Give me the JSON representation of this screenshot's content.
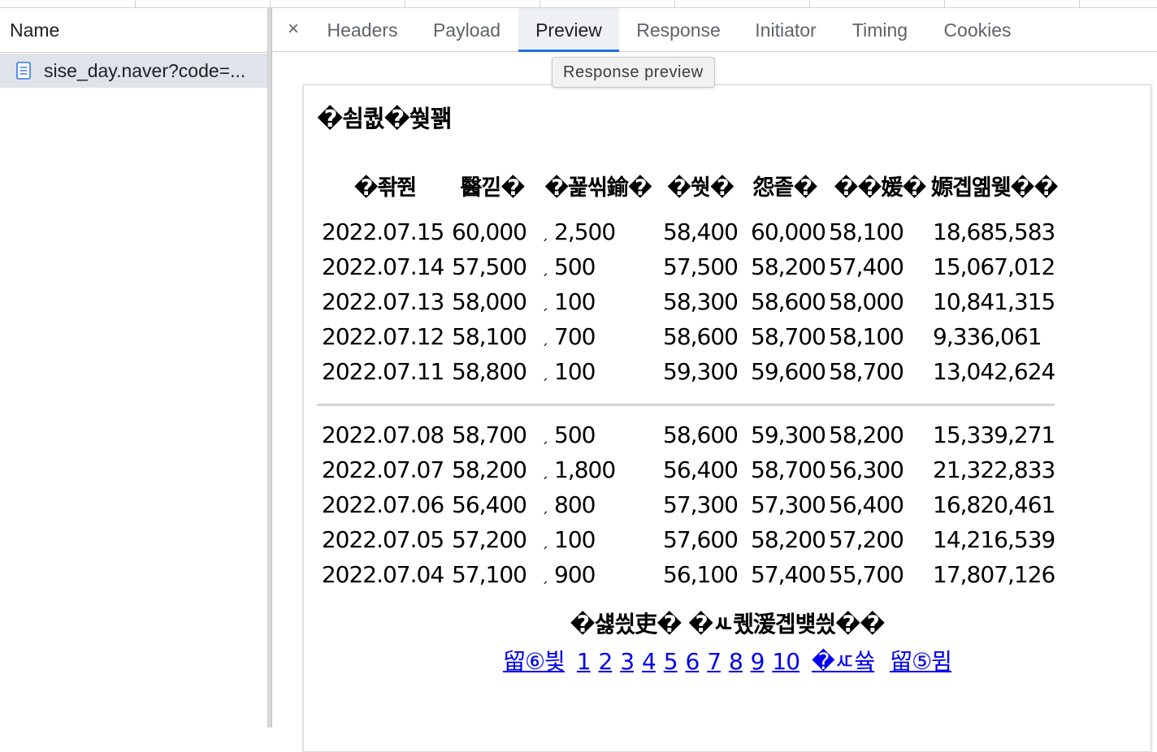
{
  "left_panel": {
    "column_header": "Name",
    "request_name": "sise_day.naver?code=..."
  },
  "tabs": {
    "close_icon": "×",
    "items": [
      "Headers",
      "Payload",
      "Preview",
      "Response",
      "Initiator",
      "Timing",
      "Cookies"
    ],
    "active": "Preview"
  },
  "tooltip": "Response preview",
  "preview": {
    "title": "�쇰퀎�쒖꽭",
    "headers": [
      "�좎쭨",
      "醫낃�",
      "�꾩씪鍮�",
      "�쒓�",
      "怨좉�",
      "��媛�",
      "嫄곕옒웾��"
    ],
    "rows_group1": [
      {
        "date": "2022.07.15",
        "close": "60,000",
        "arrow": "ˏ",
        "diff": "2,500",
        "open": "58,400",
        "high": "60,000",
        "low": "58,100",
        "volume": "18,685,583"
      },
      {
        "date": "2022.07.14",
        "close": "57,500",
        "arrow": "ˏ",
        "diff": "500",
        "open": "57,500",
        "high": "58,200",
        "low": "57,400",
        "volume": "15,067,012"
      },
      {
        "date": "2022.07.13",
        "close": "58,000",
        "arrow": "ˏ",
        "diff": "100",
        "open": "58,300",
        "high": "58,600",
        "low": "58,000",
        "volume": "10,841,315"
      },
      {
        "date": "2022.07.12",
        "close": "58,100",
        "arrow": "ˏ",
        "diff": "700",
        "open": "58,600",
        "high": "58,700",
        "low": "58,100",
        "volume": "9,336,061"
      },
      {
        "date": "2022.07.11",
        "close": "58,800",
        "arrow": "ˏ",
        "diff": "100",
        "open": "59,300",
        "high": "59,600",
        "low": "58,700",
        "volume": "13,042,624"
      }
    ],
    "rows_group2": [
      {
        "date": "2022.07.08",
        "close": "58,700",
        "arrow": "ˏ",
        "diff": "500",
        "open": "58,600",
        "high": "59,300",
        "low": "58,200",
        "volume": "15,339,271"
      },
      {
        "date": "2022.07.07",
        "close": "58,200",
        "arrow": "ˏ",
        "diff": "1,800",
        "open": "56,400",
        "high": "58,700",
        "low": "56,300",
        "volume": "21,322,833"
      },
      {
        "date": "2022.07.06",
        "close": "56,400",
        "arrow": "ˏ",
        "diff": "800",
        "open": "57,300",
        "high": "57,300",
        "low": "56,400",
        "volume": "16,820,461"
      },
      {
        "date": "2022.07.05",
        "close": "57,200",
        "arrow": "ˏ",
        "diff": "100",
        "open": "57,600",
        "high": "58,200",
        "low": "57,200",
        "volume": "14,216,539"
      },
      {
        "date": "2022.07.04",
        "close": "57,100",
        "arrow": "ˏ",
        "diff": "900",
        "open": "56,100",
        "high": "57,400",
        "low": "55,700",
        "volume": "17,807,126"
      }
    ],
    "footer_note": "�섏씠吏� �ㅻ퀬湲곕뱾씠��",
    "pager": {
      "first": "留⑥븿",
      "pages": [
        "1",
        "2",
        "3",
        "4",
        "5",
        "6",
        "7",
        "8",
        "9",
        "10"
      ],
      "next": "�ㅼ쓬",
      "last": "留⑤뮘"
    }
  }
}
